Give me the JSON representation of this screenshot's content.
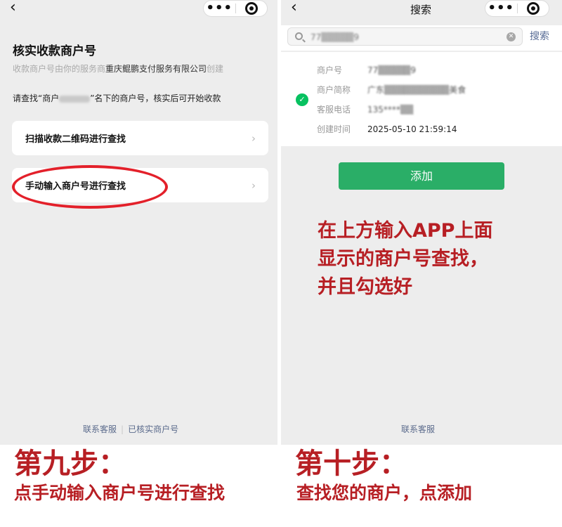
{
  "left": {
    "nav": {
      "back_icon": "chevron-left-icon",
      "more_icon": "more-dots-icon",
      "target_icon": "target-circle-icon"
    },
    "title": "核实收款商户号",
    "subtitle_prefix": "收款商户号由你的服务商",
    "subtitle_company": "重庆鲲鹏支付服务有限公司",
    "subtitle_suffix": "创建",
    "instruction_prefix": "请查找“商户",
    "instruction_suffix": "”名下的商户号，核实后可开始收款",
    "options": [
      {
        "label": "扫描收款二维码进行查找",
        "icon": "chevron-right-icon"
      },
      {
        "label": "手动输入商户号进行查找",
        "icon": "chevron-right-icon"
      }
    ],
    "links": {
      "service": "联系客服",
      "separator": "|",
      "verified": "已核实商户号"
    }
  },
  "right": {
    "nav": {
      "title": "搜索",
      "back_icon": "chevron-left-icon"
    },
    "search": {
      "value": "77▒▒▒▒▒9",
      "button": "搜索",
      "icon": "search-icon",
      "clear_icon": "clear-icon"
    },
    "result": {
      "check_icon": "check-circle-icon",
      "rows": [
        {
          "key": "商户号",
          "value": "77▒▒▒▒▒9"
        },
        {
          "key": "商户简称",
          "value": "广东▒▒▒▒▒▒▒▒▒▒美食"
        },
        {
          "key": "客服电话",
          "value": "135****▒▒"
        },
        {
          "key": "创建时间",
          "value": "2025-05-10 21:59:14"
        }
      ]
    },
    "add_button": "添加",
    "annotation": [
      "在上方输入APP上面",
      "显示的商户号查找，",
      "并且勾选好"
    ],
    "links": {
      "service": "联系客服"
    }
  },
  "captions": {
    "left_step": "第九步：",
    "left_desc": "点手动输入商户号进行查找",
    "right_step": "第十步：",
    "right_desc": "查找您的商户，点添加"
  },
  "colors": {
    "wechat_green": "#07c160",
    "button_green": "#2aae67",
    "annotation_red": "#b71f24",
    "circle_red": "#e3202a",
    "link_blue": "#576b95"
  }
}
